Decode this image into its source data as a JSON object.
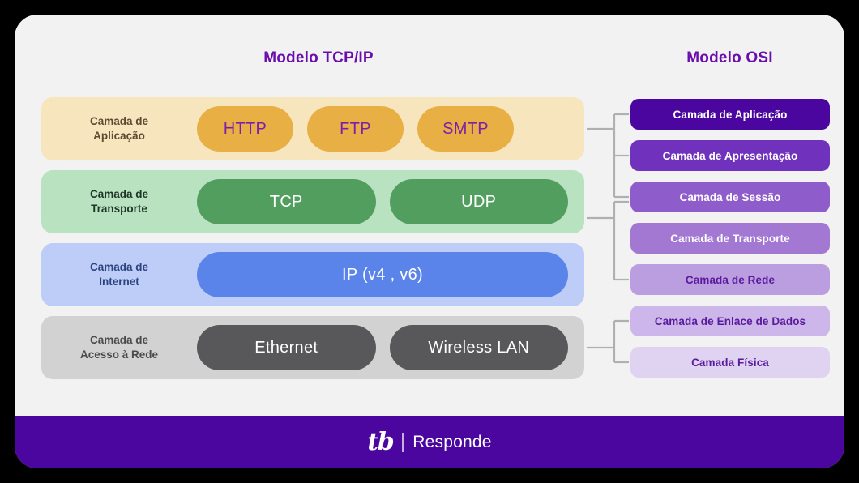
{
  "columns": {
    "tcpip_title": "Modelo TCP/IP",
    "osi_title": "Modelo OSI"
  },
  "tcpip_layers": [
    {
      "label": "Camada de\nAplicação",
      "band_color": "#f7e6bd",
      "label_color": "#5c4a33",
      "protocols": [
        {
          "name": "HTTP",
          "color": "#e8af45",
          "text_color": "#7d1fa8"
        },
        {
          "name": "FTP",
          "color": "#e8af45",
          "text_color": "#7d1fa8"
        },
        {
          "name": "SMTP",
          "color": "#e8af45",
          "text_color": "#7d1fa8"
        }
      ]
    },
    {
      "label": "Camada de\nTransporte",
      "band_color": "#b9e2c0",
      "label_color": "#1f3527",
      "protocols": [
        {
          "name": "TCP",
          "color": "#529e5f",
          "text_color": "#ffffff"
        },
        {
          "name": "UDP",
          "color": "#529e5f",
          "text_color": "#ffffff"
        }
      ]
    },
    {
      "label": "Camada de\nInternet",
      "band_color": "#bdcdf7",
      "label_color": "#2c4480",
      "protocols": [
        {
          "name": "IP (v4 , v6)",
          "color": "#5a84ea",
          "text_color": "#ffffff"
        }
      ]
    },
    {
      "label": "Camada de\nAcesso à Rede",
      "band_color": "#d2d2d2",
      "label_color": "#4a4a4a",
      "protocols": [
        {
          "name": "Ethernet",
          "color": "#58585a",
          "text_color": "#ffffff"
        },
        {
          "name": "Wireless LAN",
          "color": "#58585a",
          "text_color": "#ffffff"
        }
      ]
    }
  ],
  "osi_layers": [
    {
      "label": "Camada de Aplicação",
      "color": "#4a069e",
      "text_color": "#ffffff"
    },
    {
      "label": "Camada de Apresentação",
      "color": "#7031bd",
      "text_color": "#ffffff"
    },
    {
      "label": "Camada de Sessão",
      "color": "#8f5ccc",
      "text_color": "#ffffff"
    },
    {
      "label": "Camada de Transporte",
      "color": "#a278d3",
      "text_color": "#ffffff"
    },
    {
      "label": "Camada de Rede",
      "color": "#bb9ee0",
      "text_color": "#5a1a9e"
    },
    {
      "label": "Camada de Enlace de Dados",
      "color": "#cdb6e9",
      "text_color": "#5a1a9e"
    },
    {
      "label": "Camada Física",
      "color": "#e0d3f2",
      "text_color": "#5a1a9e"
    }
  ],
  "mappings": [
    {
      "tcpip_layer": "Camada de Aplicação",
      "osi_layers": [
        "Camada de Aplicação",
        "Camada de Apresentação",
        "Camada de Sessão"
      ]
    },
    {
      "tcpip_layer": "Camada de Transporte",
      "osi_layers": [
        "Camada de Transporte",
        "Camada de Rede"
      ]
    },
    {
      "tcpip_layer": "Camada de Acesso à Rede",
      "osi_layers": [
        "Camada de Enlace de Dados",
        "Camada Física"
      ]
    }
  ],
  "footer": {
    "logo_mark": "tb",
    "logo_divider": "|",
    "logo_word": "Responde",
    "background_color": "#4a069e"
  },
  "theme": {
    "card_background": "#f2f2f2",
    "page_background": "#000000",
    "accent_purple": "#6a0dad",
    "connector_color": "#b0b0b0"
  }
}
